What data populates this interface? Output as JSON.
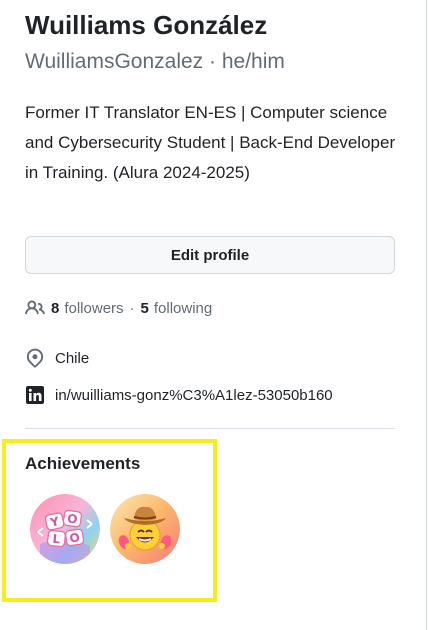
{
  "profile": {
    "name": "Wuilliams González",
    "login_line": "WuilliamsGonzalez · he/him",
    "bio": "Former IT Translator EN-ES | Computer science and Cybersecurity Student | Back-End Developer in Training. (Alura 2024-2025)"
  },
  "edit_button": {
    "label": "Edit profile"
  },
  "social": {
    "followers_count": "8",
    "followers_label": "followers",
    "separator": "·",
    "following_count": "5",
    "following_label": "following",
    "icon": "people-icon"
  },
  "details": {
    "location": {
      "icon": "location-pin-icon",
      "text": "Chile"
    },
    "linkedin": {
      "icon": "linkedin-icon",
      "text": "in/wuilliams-gonz%C3%A1lez-53050b160"
    }
  },
  "achievements": {
    "title": "Achievements",
    "badges": [
      {
        "name": "YOLO",
        "icon": "yolo-badge-icon"
      },
      {
        "name": "Cowboy",
        "icon": "cowboy-badge-icon"
      }
    ]
  },
  "colors": {
    "text_primary": "#1f2328",
    "text_muted": "#636c76",
    "border": "#d0d7de",
    "button_bg": "#f6f8fa",
    "highlight": "#f5ee1a"
  }
}
